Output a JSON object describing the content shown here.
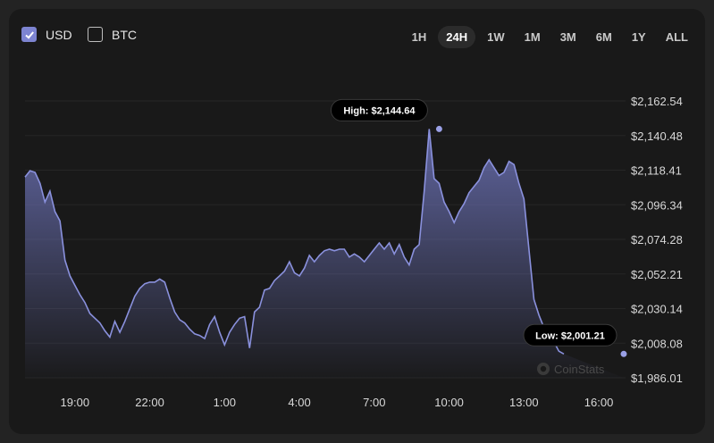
{
  "currency_toggles": [
    {
      "label": "USD",
      "checked": true
    },
    {
      "label": "BTC",
      "checked": false
    }
  ],
  "ranges": [
    "1H",
    "24H",
    "1W",
    "1M",
    "3M",
    "6M",
    "1Y",
    "ALL"
  ],
  "active_range": "24H",
  "tooltips": {
    "high": "High: $2,144.64",
    "low": "Low: $2,001.21"
  },
  "watermark": "CoinStats",
  "colors": {
    "accent": "#7d84d1",
    "background": "#191919"
  },
  "chart_data": {
    "type": "area",
    "title": "",
    "xlabel": "",
    "ylabel": "",
    "x_ticks": [
      "19:00",
      "22:00",
      "1:00",
      "4:00",
      "7:00",
      "10:00",
      "13:00",
      "16:00"
    ],
    "y_ticks": [
      "$2,162.54",
      "$2,140.48",
      "$2,118.41",
      "$2,096.34",
      "$2,074.28",
      "$2,052.21",
      "$2,030.14",
      "$2,008.08",
      "$1,986.01"
    ],
    "ylim": [
      1986.01,
      2162.54
    ],
    "grid": true,
    "series": [
      {
        "x_hours": [
          17.0,
          17.2,
          17.4,
          17.6,
          17.8,
          18.0,
          18.2,
          18.4,
          18.6,
          18.8,
          19.0,
          19.2,
          19.4,
          19.6,
          19.8,
          20.0,
          20.2,
          20.4,
          20.6,
          20.8,
          21.0,
          21.2,
          21.4,
          21.6,
          21.8,
          22.0,
          22.2,
          22.4,
          22.6,
          22.8,
          23.0,
          23.2,
          23.4,
          23.6,
          23.8,
          24.0,
          24.2,
          24.4,
          24.6,
          24.8,
          25.0,
          25.2,
          25.4,
          25.6,
          25.8,
          26.0,
          26.2,
          26.4,
          26.6,
          26.8,
          27.0,
          27.2,
          27.4,
          27.6,
          27.8,
          28.0,
          28.2,
          28.4,
          28.6,
          28.8,
          29.0,
          29.2,
          29.4,
          29.6,
          29.8,
          30.0,
          30.2,
          30.4,
          30.6,
          30.8,
          31.0,
          31.2,
          31.4,
          31.6,
          31.8,
          32.0,
          32.2,
          32.4,
          32.6,
          32.8,
          33.0,
          33.2,
          33.4,
          33.6,
          33.8,
          34.0,
          34.2,
          34.4,
          34.6,
          34.8,
          35.0,
          35.2,
          35.4,
          35.6,
          35.8,
          36.0,
          36.2,
          36.4,
          36.6,
          36.8,
          37.0,
          37.2,
          37.4,
          37.6,
          37.8,
          38.0,
          38.2,
          38.4,
          38.6,
          38.8,
          39.0,
          39.2,
          39.4,
          39.6,
          39.8,
          40.0,
          40.2,
          40.4,
          40.6,
          40.8,
          41.0
        ],
        "values": [
          2114,
          2118,
          2117,
          2110,
          2098,
          2105,
          2092,
          2086,
          2061,
          2051,
          2045,
          2039,
          2034,
          2027,
          2024,
          2021,
          2016,
          2012,
          2022,
          2015,
          2022,
          2030,
          2038,
          2043,
          2046,
          2047,
          2047,
          2049,
          2047,
          2037,
          2028,
          2023,
          2021,
          2017,
          2014,
          2013,
          2011,
          2020,
          2025,
          2015,
          2007,
          2015,
          2020,
          2024,
          2025,
          2005,
          2028,
          2031,
          2042,
          2043,
          2048,
          2051,
          2054,
          2060,
          2053,
          2051,
          2056,
          2064,
          2060,
          2064,
          2067,
          2068,
          2067,
          2068,
          2068,
          2063,
          2065,
          2063,
          2060,
          2064,
          2068,
          2072,
          2068,
          2072,
          2065,
          2071,
          2063,
          2058,
          2068,
          2071,
          2105,
          2144.64,
          2113,
          2110,
          2098,
          2092,
          2085,
          2092,
          2097,
          2104,
          2108,
          2112,
          2120,
          2125,
          2120,
          2115,
          2117,
          2124,
          2122,
          2110,
          2100,
          2068,
          2036,
          2026,
          2018,
          2011,
          2009,
          2003,
          2001.21
        ]
      }
    ],
    "high_point": {
      "x_hours": 33.6,
      "value": 2144.64
    },
    "low_point": {
      "x_hours": 41.0,
      "value": 2001.21
    }
  }
}
